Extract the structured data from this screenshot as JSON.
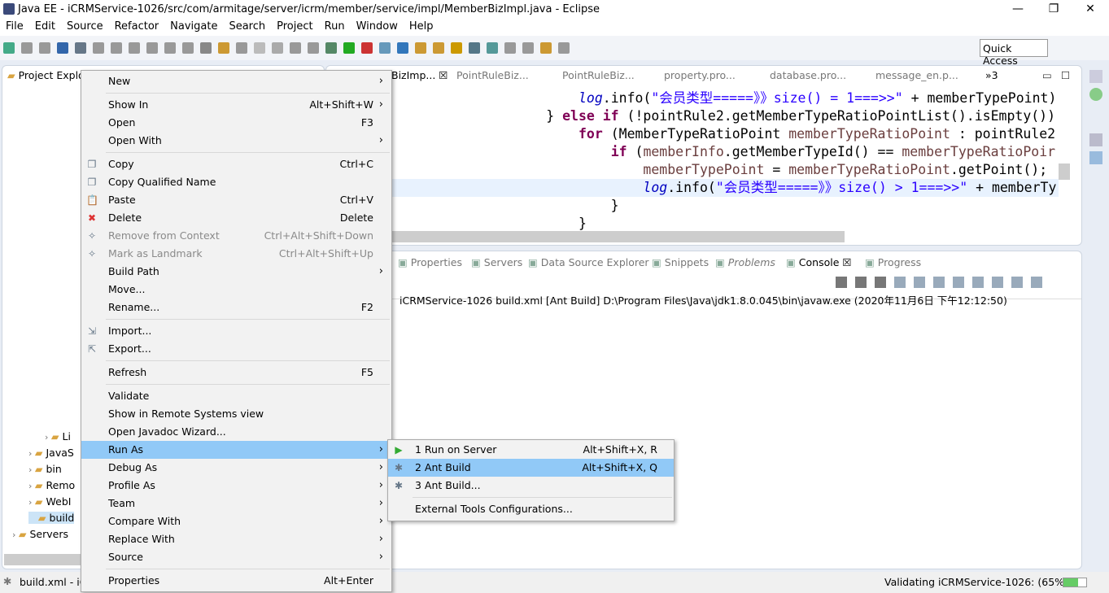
{
  "window": {
    "title": "Java EE - iCRMService-1026/src/com/armitage/server/icrm/member/service/impl/MemberBizImpl.java - Eclipse",
    "minimize": "—",
    "restore": "❐",
    "close": "✕"
  },
  "menubar": [
    "File",
    "Edit",
    "Source",
    "Refactor",
    "Navigate",
    "Search",
    "Project",
    "Run",
    "Window",
    "Help"
  ],
  "toolbar": {
    "quick_access": "Quick Access"
  },
  "project_explorer": {
    "tab": "Project Explo",
    "items": [
      {
        "label": "Li",
        "chev": true
      },
      {
        "label": "JavaS",
        "chev": true
      },
      {
        "label": "bin",
        "chev": true
      },
      {
        "label": "Remo",
        "chev": true
      },
      {
        "label": "WebI",
        "chev": true
      },
      {
        "label": "build",
        "chev": false
      },
      {
        "label": "Servers",
        "chev": true
      }
    ]
  },
  "editor": {
    "tabs": [
      "BizImp...",
      "PointRuleBiz...",
      "PointRuleBiz...",
      "property.pro...",
      "database.pro...",
      "message_en.p..."
    ],
    "overflow": "»3",
    "lines": [
      [
        [
          "                ",
          ""
        ],
        [
          "log",
          "fld"
        ],
        [
          ".info(",
          ""
        ],
        [
          "\"会员类型=====》》size() = 1===>>\"",
          "str"
        ],
        [
          " + memberTypePoint)",
          ""
        ]
      ],
      [
        [
          "            } ",
          ""
        ],
        [
          "else if",
          "kw"
        ],
        [
          " (!pointRule2.getMemberTypeRatioPointList().isEmpty())",
          ""
        ]
      ],
      [
        [
          "                ",
          ""
        ],
        [
          "for",
          "kw"
        ],
        [
          " (MemberTypeRatioPoint ",
          ""
        ],
        [
          "memberTypeRatioPoint",
          "var"
        ],
        [
          " : pointRule2",
          ""
        ]
      ],
      [
        [
          "                    ",
          ""
        ],
        [
          "if",
          "kw"
        ],
        [
          " (",
          ""
        ],
        [
          "memberInfo",
          "var"
        ],
        [
          ".getMemberTypeId() == ",
          ""
        ],
        [
          "memberTypeRatioPoir",
          "var"
        ]
      ],
      [
        [
          "                        ",
          ""
        ],
        [
          "memberTypePoint",
          "var"
        ],
        [
          " = ",
          ""
        ],
        [
          "memberTypeRatioPoint",
          "var"
        ],
        [
          ".getPoint();",
          ""
        ]
      ],
      [
        [
          "                        ",
          ""
        ],
        [
          "log",
          "fld"
        ],
        [
          ".info(",
          ""
        ],
        [
          "\"会员类型=====》》size() > 1===>>\"",
          "str"
        ],
        [
          " + memberTy",
          ""
        ]
      ],
      [
        [
          "                    }",
          ""
        ]
      ],
      [
        [
          "                }",
          ""
        ]
      ]
    ]
  },
  "console": {
    "tabs": [
      "Properties",
      "Servers",
      "Data Source Explorer",
      "Snippets",
      "Problems",
      "Console",
      "Progress"
    ],
    "active": "Console",
    "header": "iCRMService-1026 build.xml [Ant Build] D:\\Program Files\\Java\\jdk1.8.0.045\\bin\\javaw.exe (2020年11月6日 下午12:12:50)"
  },
  "context_menu": {
    "items": [
      {
        "label": "New",
        "sub": true
      },
      {
        "sep": true
      },
      {
        "label": "Show In",
        "acc": "Alt+Shift+W",
        "sub": true
      },
      {
        "label": "Open",
        "acc": "F3"
      },
      {
        "label": "Open With",
        "sub": true
      },
      {
        "sep": true
      },
      {
        "label": "Copy",
        "acc": "Ctrl+C",
        "icon": "copy-icon"
      },
      {
        "label": "Copy Qualified Name",
        "icon": "copy-qualified-icon"
      },
      {
        "label": "Paste",
        "acc": "Ctrl+V",
        "icon": "paste-icon"
      },
      {
        "label": "Delete",
        "acc": "Delete",
        "icon": "delete-icon"
      },
      {
        "label": "Remove from Context",
        "acc": "Ctrl+Alt+Shift+Down",
        "disabled": true,
        "icon": "remove-context-icon"
      },
      {
        "label": "Mark as Landmark",
        "acc": "Ctrl+Alt+Shift+Up",
        "disabled": true,
        "icon": "landmark-icon"
      },
      {
        "label": "Build Path",
        "sub": true
      },
      {
        "label": "Move..."
      },
      {
        "label": "Rename...",
        "acc": "F2"
      },
      {
        "sep": true
      },
      {
        "label": "Import...",
        "icon": "import-icon"
      },
      {
        "label": "Export...",
        "icon": "export-icon"
      },
      {
        "sep": true
      },
      {
        "label": "Refresh",
        "acc": "F5"
      },
      {
        "sep": true
      },
      {
        "label": "Validate"
      },
      {
        "label": "Show in Remote Systems view"
      },
      {
        "label": "Open Javadoc Wizard..."
      },
      {
        "label": "Run As",
        "sub": true,
        "selected": true
      },
      {
        "label": "Debug As",
        "sub": true
      },
      {
        "label": "Profile As",
        "sub": true
      },
      {
        "label": "Team",
        "sub": true
      },
      {
        "label": "Compare With",
        "sub": true
      },
      {
        "label": "Replace With",
        "sub": true
      },
      {
        "label": "Source",
        "sub": true
      },
      {
        "sep": true
      },
      {
        "label": "Properties",
        "acc": "Alt+Enter"
      }
    ]
  },
  "run_as_submenu": {
    "items": [
      {
        "label": "1 Run on Server",
        "acc": "Alt+Shift+X, R",
        "icon": "server-run-icon"
      },
      {
        "label": "2 Ant Build",
        "acc": "Alt+Shift+X, Q",
        "icon": "ant-icon",
        "selected": true
      },
      {
        "label": "3 Ant Build...",
        "icon": "ant-icon"
      },
      {
        "sep": true
      },
      {
        "label": "External Tools Configurations..."
      }
    ]
  },
  "status": {
    "left": "build.xml - iC",
    "progress_text": "Validating iCRMService-1026: (65%)",
    "progress": 0.65
  },
  "colors": {
    "selection": "#91c9f7",
    "keyword": "#7f0055",
    "string": "#2a00ff",
    "field": "#0000c0"
  }
}
